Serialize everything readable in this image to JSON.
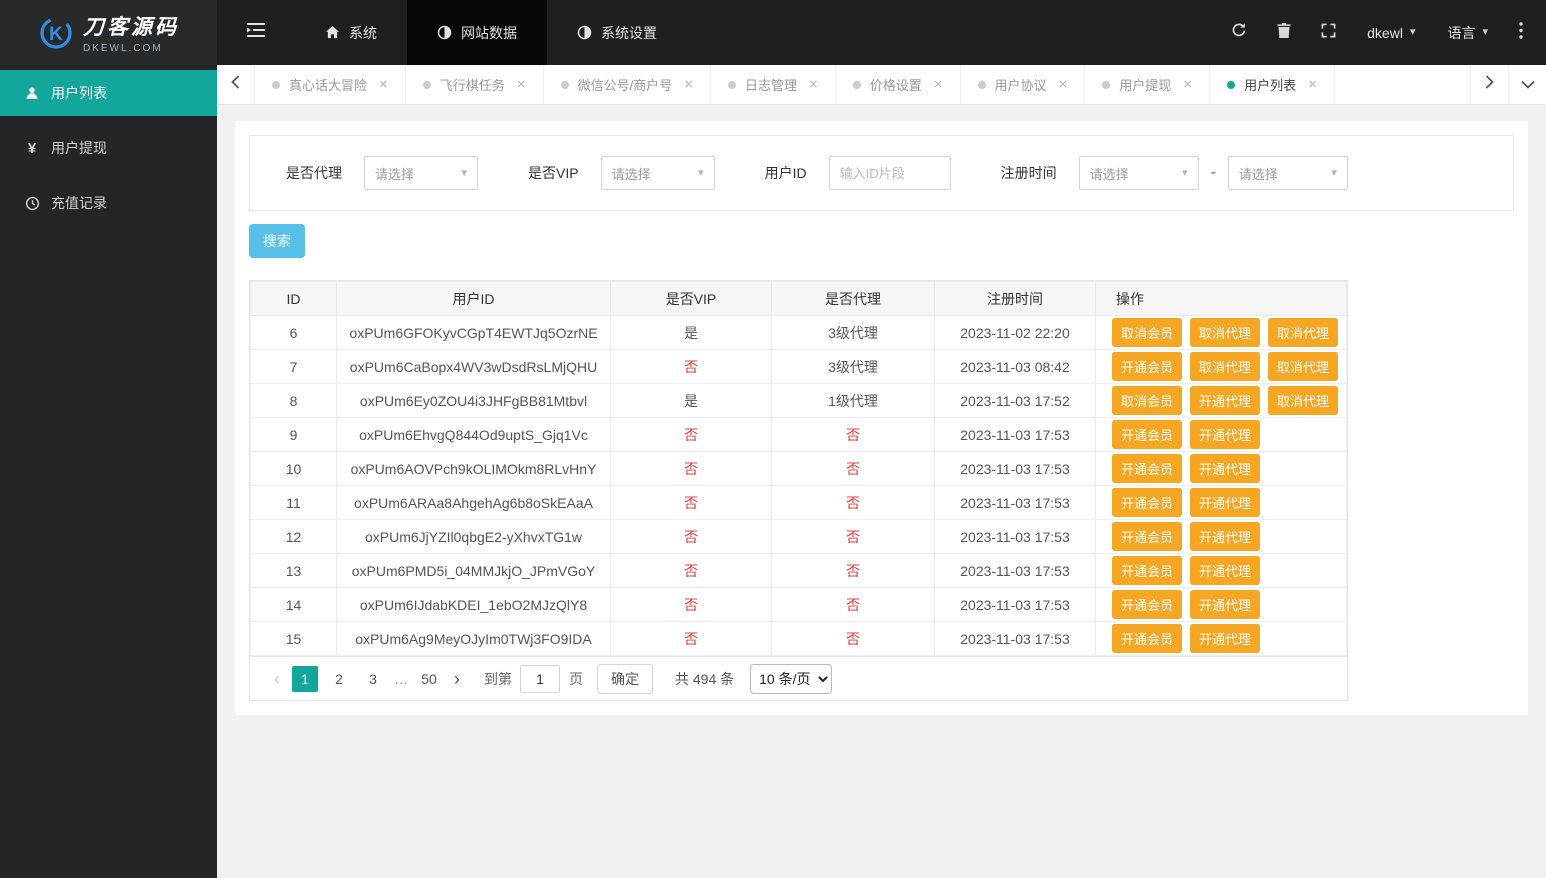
{
  "colors": {
    "accent": "#13a79b",
    "warning": "#f5a623",
    "info": "#56c0e8",
    "danger": "#e23c3c"
  },
  "brand": {
    "logo_main": "刀客源码",
    "logo_sub": "DKEWL.COM"
  },
  "topnav": {
    "items": [
      {
        "label": "系统",
        "icon": "home-icon",
        "active": false
      },
      {
        "label": "网站数据",
        "icon": "pie-icon",
        "active": true
      },
      {
        "label": "系统设置",
        "icon": "pie-icon",
        "active": false
      }
    ],
    "user_label": "dkewl",
    "language_label": "语言"
  },
  "sidebar": {
    "items": [
      {
        "label": "用户列表",
        "icon": "user-icon",
        "active": true
      },
      {
        "label": "用户提现",
        "icon": "yen-icon",
        "active": false
      },
      {
        "label": "充值记录",
        "icon": "clock-icon",
        "active": false
      }
    ]
  },
  "tabs": {
    "items": [
      {
        "label": "真心话大冒险",
        "active": false
      },
      {
        "label": "飞行棋任务",
        "active": false
      },
      {
        "label": "微信公号/商户号",
        "active": false
      },
      {
        "label": "日志管理",
        "active": false
      },
      {
        "label": "价格设置",
        "active": false
      },
      {
        "label": "用户协议",
        "active": false
      },
      {
        "label": "用户提现",
        "active": false
      },
      {
        "label": "用户列表",
        "active": true
      }
    ],
    "close_glyph": "×"
  },
  "filters": {
    "agent_label": "是否代理",
    "vip_label": "是否VIP",
    "userid_label": "用户ID",
    "regtime_label": "注册时间",
    "select_placeholder": "请选择",
    "userid_placeholder": "输入ID片段",
    "dash": "-",
    "search_label": "搜索"
  },
  "table": {
    "headers": [
      "ID",
      "用户ID",
      "是否VIP",
      "是否代理",
      "注册时间",
      "操作"
    ],
    "rows": [
      {
        "id": "6",
        "user_id": "oxPUm6GFOKyvCGpT4EWTJq5OzrNE",
        "vip": "是",
        "agent": "3级代理",
        "time": "2023-11-02 22:20",
        "actions": [
          "取消会员",
          "取消代理",
          "取消代理"
        ]
      },
      {
        "id": "7",
        "user_id": "oxPUm6CaBopx4WV3wDsdRsLMjQHU",
        "vip": "否",
        "agent": "3级代理",
        "time": "2023-11-03 08:42",
        "actions": [
          "开通会员",
          "取消代理",
          "取消代理"
        ]
      },
      {
        "id": "8",
        "user_id": "oxPUm6Ey0ZOU4i3JHFgBB81Mtbvl",
        "vip": "是",
        "agent": "1级代理",
        "time": "2023-11-03 17:52",
        "actions": [
          "取消会员",
          "开通代理",
          "取消代理"
        ]
      },
      {
        "id": "9",
        "user_id": "oxPUm6EhvgQ844Od9uptS_Gjq1Vc",
        "vip": "否",
        "agent": "否",
        "time": "2023-11-03 17:53",
        "actions": [
          "开通会员",
          "开通代理"
        ]
      },
      {
        "id": "10",
        "user_id": "oxPUm6AOVPch9kOLIMOkm8RLvHnY",
        "vip": "否",
        "agent": "否",
        "time": "2023-11-03 17:53",
        "actions": [
          "开通会员",
          "开通代理"
        ]
      },
      {
        "id": "11",
        "user_id": "oxPUm6ARAa8AhgehAg6b8oSkEAaA",
        "vip": "否",
        "agent": "否",
        "time": "2023-11-03 17:53",
        "actions": [
          "开通会员",
          "开通代理"
        ]
      },
      {
        "id": "12",
        "user_id": "oxPUm6JjYZIl0qbgE2-yXhvxTG1w",
        "vip": "否",
        "agent": "否",
        "time": "2023-11-03 17:53",
        "actions": [
          "开通会员",
          "开通代理"
        ]
      },
      {
        "id": "13",
        "user_id": "oxPUm6PMD5i_04MMJkjO_JPmVGoY",
        "vip": "否",
        "agent": "否",
        "time": "2023-11-03 17:53",
        "actions": [
          "开通会员",
          "开通代理"
        ]
      },
      {
        "id": "14",
        "user_id": "oxPUm6IJdabKDEI_1ebO2MJzQlY8",
        "vip": "否",
        "agent": "否",
        "time": "2023-11-03 17:53",
        "actions": [
          "开通会员",
          "开通代理"
        ]
      },
      {
        "id": "15",
        "user_id": "oxPUm6Ag9MeyOJyIm0TWj3FO9IDA",
        "vip": "否",
        "agent": "否",
        "time": "2023-11-03 17:53",
        "actions": [
          "开通会员",
          "开通代理"
        ]
      }
    ]
  },
  "pagination": {
    "prev_glyph": "‹",
    "next_glyph": "›",
    "pages": [
      "1",
      "2",
      "3",
      "…",
      "50"
    ],
    "active_index": 0,
    "goto_label": "到第",
    "goto_value": "1",
    "page_unit": "页",
    "confirm_label": "确定",
    "total_text": "共 494 条",
    "per_page": "10 条/页"
  }
}
